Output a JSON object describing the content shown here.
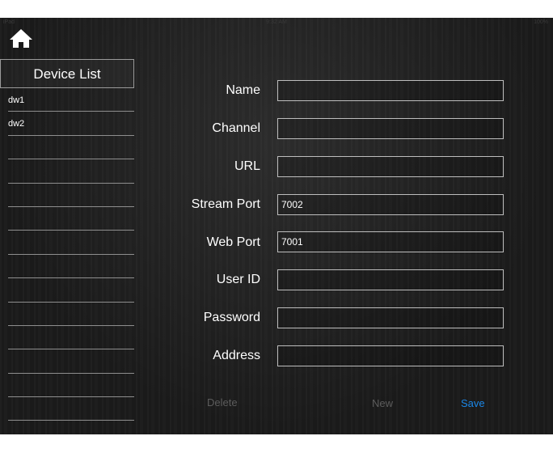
{
  "status": {
    "carrier": "iPad",
    "time": "9:32 AM",
    "battery": "100%"
  },
  "home": {
    "icon": "home-icon"
  },
  "device_list": {
    "title": "Device List",
    "items": [
      "dw1",
      "dw2",
      "",
      "",
      "",
      "",
      "",
      "",
      "",
      "",
      "",
      "",
      "",
      ""
    ]
  },
  "form": {
    "fields": [
      {
        "label": "Name",
        "value": ""
      },
      {
        "label": "Channel",
        "value": ""
      },
      {
        "label": "URL",
        "value": ""
      },
      {
        "label": "Stream Port",
        "value": "7002"
      },
      {
        "label": "Web Port",
        "value": "7001"
      },
      {
        "label": "User ID",
        "value": ""
      },
      {
        "label": "Password",
        "value": ""
      },
      {
        "label": "Address",
        "value": ""
      }
    ]
  },
  "actions": {
    "delete": "Delete",
    "new": "New",
    "save": "Save"
  },
  "colors": {
    "background": "#1b1b1b",
    "text": "#ffffff",
    "disabled": "#5c5c5c",
    "accent": "#1a86e6",
    "border": "#bdbdbd"
  }
}
